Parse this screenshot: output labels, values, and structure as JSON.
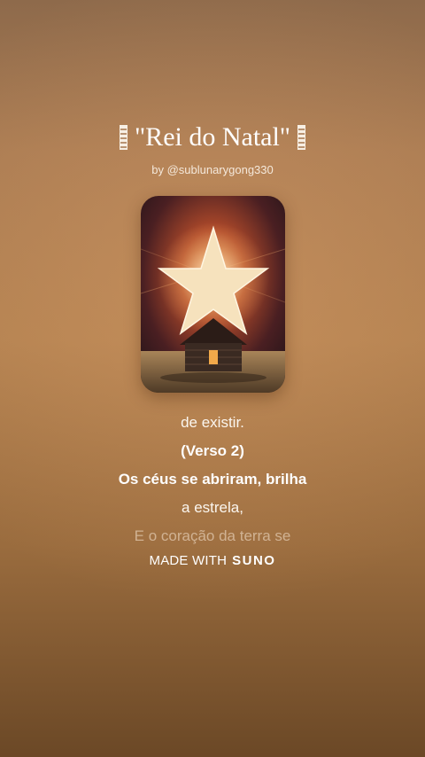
{
  "song": {
    "title": "\"Rei do Natal\"",
    "byline": "by @sublunarygong330"
  },
  "lyrics": [
    {
      "text": "de existir.",
      "state": "normal"
    },
    {
      "text": "(Verso 2)",
      "state": "active"
    },
    {
      "text": "Os céus se abriram, brilha",
      "state": "active"
    },
    {
      "text": "a estrela,",
      "state": "normal"
    },
    {
      "text": "E o coração da terra se",
      "state": "faded"
    }
  ],
  "footer": {
    "made_with": "MADE WITH",
    "brand": "SUNO"
  },
  "cover_art": {
    "icon": "star-over-house-artwork"
  },
  "colors": {
    "background_top": "#8e6a4b",
    "background_bottom": "#6b4826",
    "text": "#ffffff"
  }
}
